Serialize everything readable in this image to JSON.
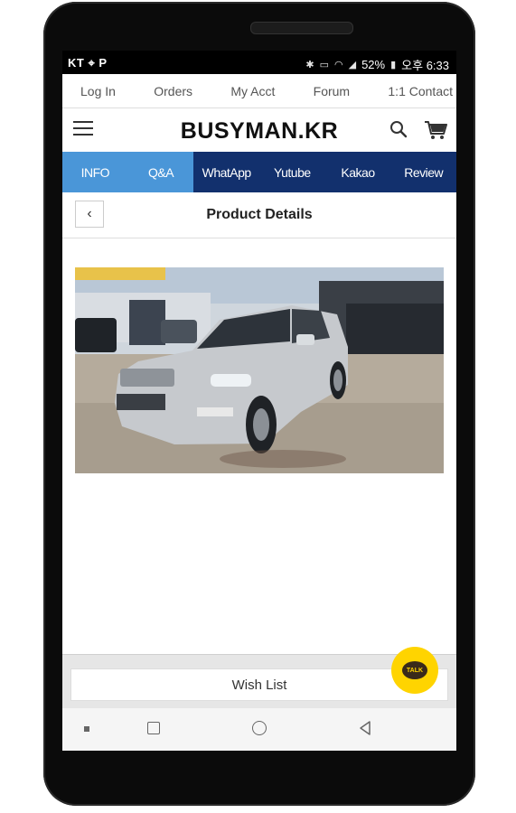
{
  "status_bar": {
    "carrier": "KT ⌖ P",
    "battery": "52%",
    "clock": "오후 6:33"
  },
  "top_nav": {
    "items": [
      "Log In",
      "Orders",
      "My Acct",
      "Forum",
      "1:1 Contact"
    ]
  },
  "header": {
    "brand": "BUSYMAN.KR"
  },
  "tabs": [
    {
      "label": "INFO",
      "style": "light"
    },
    {
      "label": "Q&A",
      "style": "light"
    },
    {
      "label": "WhatApp",
      "style": "dark"
    },
    {
      "label": "Yutube",
      "style": "dark"
    },
    {
      "label": "Kakao",
      "style": "dark"
    },
    {
      "label": "Review",
      "style": "dark"
    }
  ],
  "subheader": {
    "title": "Product Details",
    "back_glyph": "‹"
  },
  "bottom": {
    "wishlist_label": "Wish List",
    "talk_label": "TALK"
  },
  "colors": {
    "tab_light": "#4a96d8",
    "tab_dark": "#12306d",
    "talk_yellow": "#ffd400"
  }
}
